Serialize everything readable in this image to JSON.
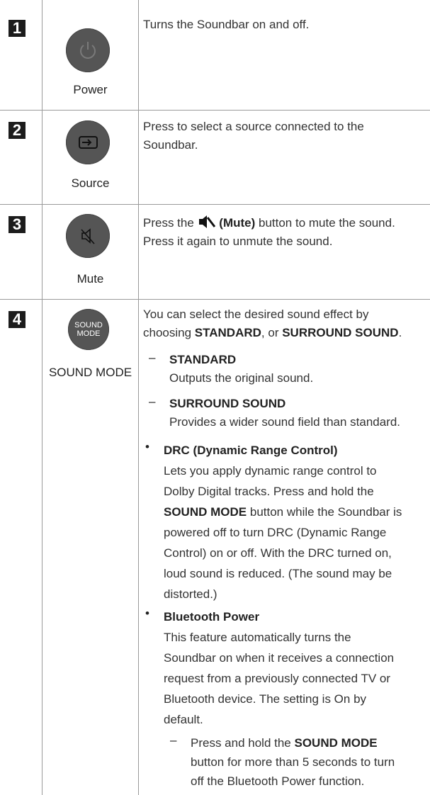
{
  "rows": [
    {
      "number": "1",
      "icon": "power-icon",
      "label": "Power",
      "desc": "Turns the Soundbar on and off."
    },
    {
      "number": "2",
      "icon": "source-icon",
      "label": "Source",
      "desc_lines": [
        "Press to select a source connected to the",
        "Soundbar."
      ]
    },
    {
      "number": "3",
      "icon": "mute-icon",
      "label": "Mute",
      "desc": {
        "pre": "Press the",
        "bold": "(Mute)",
        "post": "button to mute the sound.",
        "line2": "Press it again to unmute the sound."
      }
    },
    {
      "number": "4",
      "icon": "sound-mode-icon",
      "icon_text": [
        "SOUND",
        "MODE"
      ],
      "label": "SOUND MODE",
      "intro": {
        "line1": "You can select the desired sound effect by",
        "pre": "choosing",
        "opt1": "STANDARD",
        "mid": ", or",
        "opt2": "SURROUND SOUND",
        "end": "."
      },
      "modes": [
        {
          "dash": "–",
          "name": "STANDARD",
          "text": "Outputs the original sound."
        },
        {
          "dash": "–",
          "name": "SURROUND SOUND",
          "text": "Provides a wider sound field than standard."
        }
      ],
      "drc": {
        "bullet": "•",
        "title": "DRC (Dynamic Range Control)",
        "l1": "Lets you apply dynamic range control to",
        "l2": "Dolby Digital tracks. Press and hold the",
        "l3_bold": "SOUND MODE",
        "l3_rest": "button while the Soundbar is",
        "l4": "powered off to turn DRC (Dynamic Range",
        "l5": "Control) on or off. With the DRC turned on,",
        "l6": "loud sound is reduced. (The sound may be",
        "l7": "distorted.)"
      },
      "bt": {
        "bullet": "•",
        "title": "Bluetooth Power",
        "l1": "This feature automatically turns the",
        "l2": "Soundbar on when it receives a connection",
        "l3": "request from a previously connected TV or",
        "l4": "Bluetooth device. The setting is On by",
        "l5": "default.",
        "sub_dash": "–",
        "s1_pre": "Press and hold the",
        "s1_bold": "SOUND MODE",
        "s2": "button for more than 5 seconds to turn",
        "s3": "off the Bluetooth Power function."
      }
    }
  ]
}
